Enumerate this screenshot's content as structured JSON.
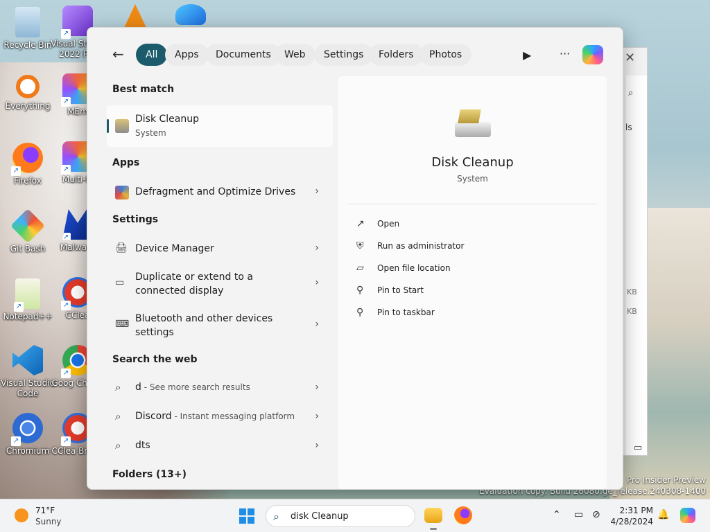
{
  "desktop": {
    "icons": [
      {
        "label": "Recycle Bin"
      },
      {
        "label": "Visual Studio 2022 Pre"
      },
      {
        "label": "Everything"
      },
      {
        "label": "MEm"
      },
      {
        "label": "Firefox"
      },
      {
        "label": "Multi-M"
      },
      {
        "label": "Git Bash"
      },
      {
        "label": "Malware"
      },
      {
        "label": "Notepad++"
      },
      {
        "label": "CClea"
      },
      {
        "label": "Visual Studio Code"
      },
      {
        "label": "Goog Chrom"
      },
      {
        "label": "Chromium"
      },
      {
        "label": "CClea Brows"
      }
    ],
    "watermark": {
      "line1": "11 Pro Insider Preview",
      "line2": "Evaluation copy. Build 26080.ge_release.240308-1400"
    },
    "bg_window": {
      "close": "✕",
      "frag1": "ls",
      "frag2": "KB",
      "frag3": "KB"
    }
  },
  "start": {
    "back": "←",
    "filters": [
      "All",
      "Apps",
      "Documents",
      "Web",
      "Settings",
      "Folders",
      "Photos"
    ],
    "active_filter": "All",
    "more": "···",
    "best_match_heading": "Best match",
    "best_match": {
      "title": "Disk Cleanup",
      "subtitle": "System"
    },
    "apps_heading": "Apps",
    "apps": [
      {
        "label": "Defragment and Optimize Drives"
      }
    ],
    "settings_heading": "Settings",
    "settings": [
      {
        "label": "Device Manager"
      },
      {
        "label": "Duplicate or extend to a connected display"
      },
      {
        "label": "Bluetooth and other devices settings"
      }
    ],
    "web_heading": "Search the web",
    "web": [
      {
        "query": "d",
        "hint": " - See more search results"
      },
      {
        "query": "Discord",
        "hint": " - Instant messaging platform"
      },
      {
        "query": "dts",
        "hint": ""
      }
    ],
    "folders_heading": "Folders (13+)",
    "detail": {
      "title": "Disk Cleanup",
      "subtitle": "System",
      "actions": [
        "Open",
        "Run as administrator",
        "Open file location",
        "Pin to Start",
        "Pin to taskbar"
      ]
    }
  },
  "taskbar": {
    "weather": {
      "temp": "71°F",
      "cond": "Sunny"
    },
    "search_value": "disk Cleanup",
    "time": "2:31 PM",
    "date": "4/28/2024"
  }
}
